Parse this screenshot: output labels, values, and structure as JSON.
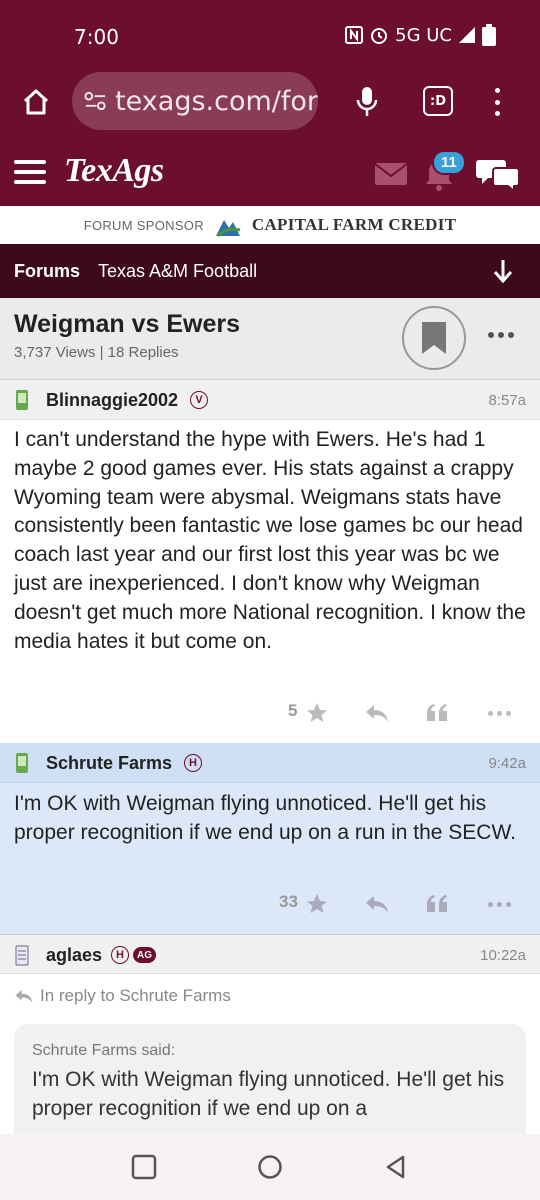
{
  "status_bar": {
    "time": "7:00",
    "network": "5G UC"
  },
  "browser": {
    "url": "texags.com/for",
    "tabs_label": ":D"
  },
  "site": {
    "logo": "TexAgs",
    "notification_count": "11"
  },
  "sponsor": {
    "label": "FORUM SPONSOR",
    "brand": "CAPITAL FARM CREDIT"
  },
  "breadcrumb": {
    "forums": "Forums",
    "section": "Texas A&M Football"
  },
  "thread": {
    "title": "Weigman vs Ewers",
    "meta": "3,737 Views | 18 Replies"
  },
  "posts": [
    {
      "user": "Blinnaggie2002",
      "badge": "V",
      "time": "8:57a",
      "body": "I can't understand the hype with Ewers. He's had 1 maybe 2 good games ever. His stats against a crappy Wyoming team were abysmal. Weigmans stats have consistently been fantastic we lose games bc our head coach last year and our first lost this year was bc we just are inexperienced. I don't know why Weigman doesn't get much more National recognition. I know the media hates it but come on.",
      "likes": "5"
    },
    {
      "user": "Schrute Farms",
      "badge": "H",
      "time": "9:42a",
      "body": "I'm OK with Weigman flying unnoticed. He'll get his proper recognition if we end up on a run in the SECW.",
      "likes": "33"
    },
    {
      "user": "aglaes",
      "badge": "H",
      "badge2": "AG",
      "time": "10:22a",
      "reply_to": "In reply to Schrute Farms",
      "quote_head": "Schrute Farms said:",
      "quote_body": "I'm OK with Weigman flying unnoticed. He'll get his proper recognition if we end up on a"
    }
  ],
  "colors": {
    "maroon": "#6b0e2f",
    "dark_maroon": "#3d0a1c",
    "highlight": "#dce8f8"
  }
}
